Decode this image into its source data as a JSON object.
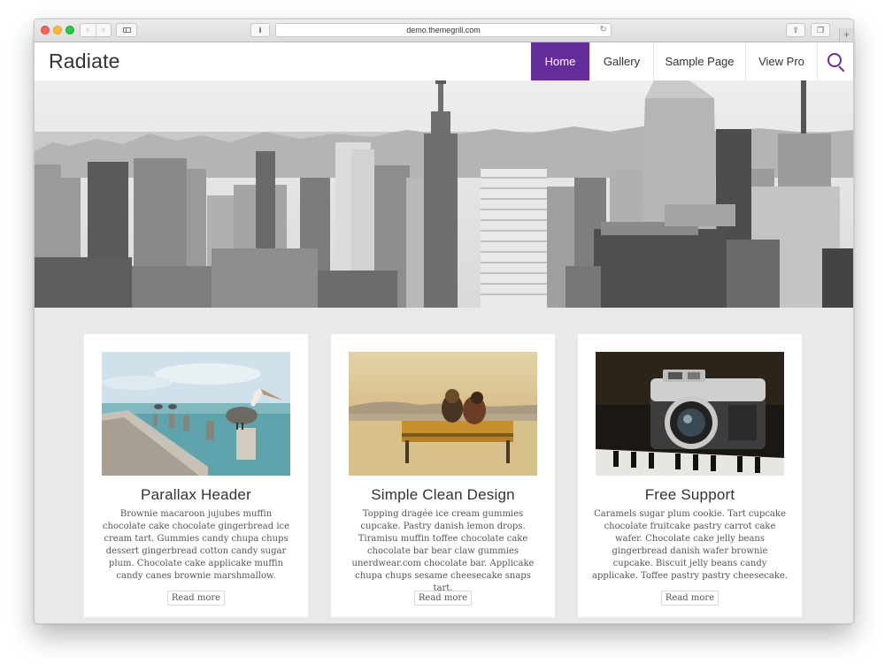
{
  "browser": {
    "url": "demo.themegrill.com",
    "info_label": "i",
    "back_label": "‹",
    "forward_label": "›",
    "reload_label": "↻",
    "share_label": "⇧",
    "tabs_label": "❐",
    "new_tab_label": "+"
  },
  "site": {
    "title": "Radiate",
    "nav": {
      "home": "Home",
      "gallery": "Gallery",
      "sample_page": "Sample Page",
      "view_pro": "View Pro"
    },
    "accent_color": "#632e9b"
  },
  "cards": [
    {
      "title": "Parallax Header",
      "text": "Brownie macaroon jujubes muffin chocolate cake chocolate gingerbread ice cream tart. Gummies candy chupa chups dessert gingerbread cotton candy sugar plum. Chocolate cake applicake muffin candy canes brownie marshmallow.",
      "button": "Read more"
    },
    {
      "title": "Simple Clean Design",
      "text": "Topping dragée ice cream gummies cupcake. Pastry danish lemon drops. Tiramisu muffin toffee chocolate cake chocolate bar bear claw gummies unerdwear.com chocolate bar. Applicake chupa chups sesame cheesecake snaps tart.",
      "button": "Read more"
    },
    {
      "title": "Free Support",
      "text": "Caramels sugar plum cookie. Tart cupcake chocolate fruitcake pastry carrot cake wafer. Chocolate cake jelly beans gingerbread danish wafer brownie cupcake. Biscuit jelly beans candy applicake. Toffee pastry pastry cheesecake.",
      "button": "Read more"
    }
  ]
}
